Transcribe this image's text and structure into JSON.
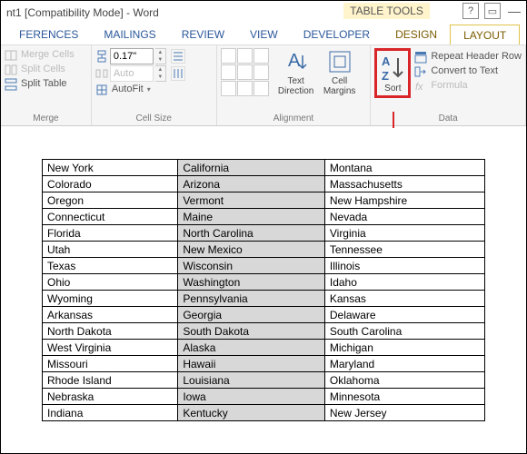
{
  "title": "nt1 [Compatibility Mode] - Word",
  "context_tools_label": "TABLE TOOLS",
  "tabs": {
    "references": "FERENCES",
    "mailings": "MAILINGS",
    "review": "REVIEW",
    "view": "VIEW",
    "developer": "DEVELOPER",
    "design": "DESIGN",
    "layout": "LAYOUT"
  },
  "ribbon": {
    "merge": {
      "label": "Merge",
      "merge_cells": "Merge Cells",
      "split_cells": "Split Cells",
      "split_table": "Split Table"
    },
    "cellsize": {
      "label": "Cell Size",
      "height_value": "0.17\"",
      "width_value": "Auto",
      "autofit": "AutoFit"
    },
    "alignment": {
      "label": "Alignment",
      "text_direction": "Text Direction",
      "cell_margins": "Cell Margins"
    },
    "data": {
      "label": "Data",
      "sort": "Sort",
      "repeat_header": "Repeat Header Row",
      "convert_text": "Convert to Text",
      "formula": "Formula"
    }
  },
  "table": {
    "rows": [
      [
        "New York",
        "California",
        "Montana"
      ],
      [
        "Colorado",
        "Arizona",
        "Massachusetts"
      ],
      [
        "Oregon",
        "Vermont",
        "New Hampshire"
      ],
      [
        "Connecticut",
        "Maine",
        "Nevada"
      ],
      [
        "Florida",
        "North Carolina",
        "Virginia"
      ],
      [
        "Utah",
        "New Mexico",
        "Tennessee"
      ],
      [
        "Texas",
        "Wisconsin",
        "Illinois"
      ],
      [
        "Ohio",
        "Washington",
        "Idaho"
      ],
      [
        "Wyoming",
        "Pennsylvania",
        "Kansas"
      ],
      [
        "Arkansas",
        "Georgia",
        "Delaware"
      ],
      [
        "North Dakota",
        "South Dakota",
        "South Carolina"
      ],
      [
        "West Virginia",
        "Alaska",
        "Michigan"
      ],
      [
        "Missouri",
        "Hawaii",
        "Maryland"
      ],
      [
        "Rhode Island",
        "Louisiana",
        "Oklahoma"
      ],
      [
        "Nebraska",
        "Iowa",
        "Minnesota"
      ],
      [
        "Indiana",
        "Kentucky",
        "New Jersey"
      ]
    ]
  }
}
